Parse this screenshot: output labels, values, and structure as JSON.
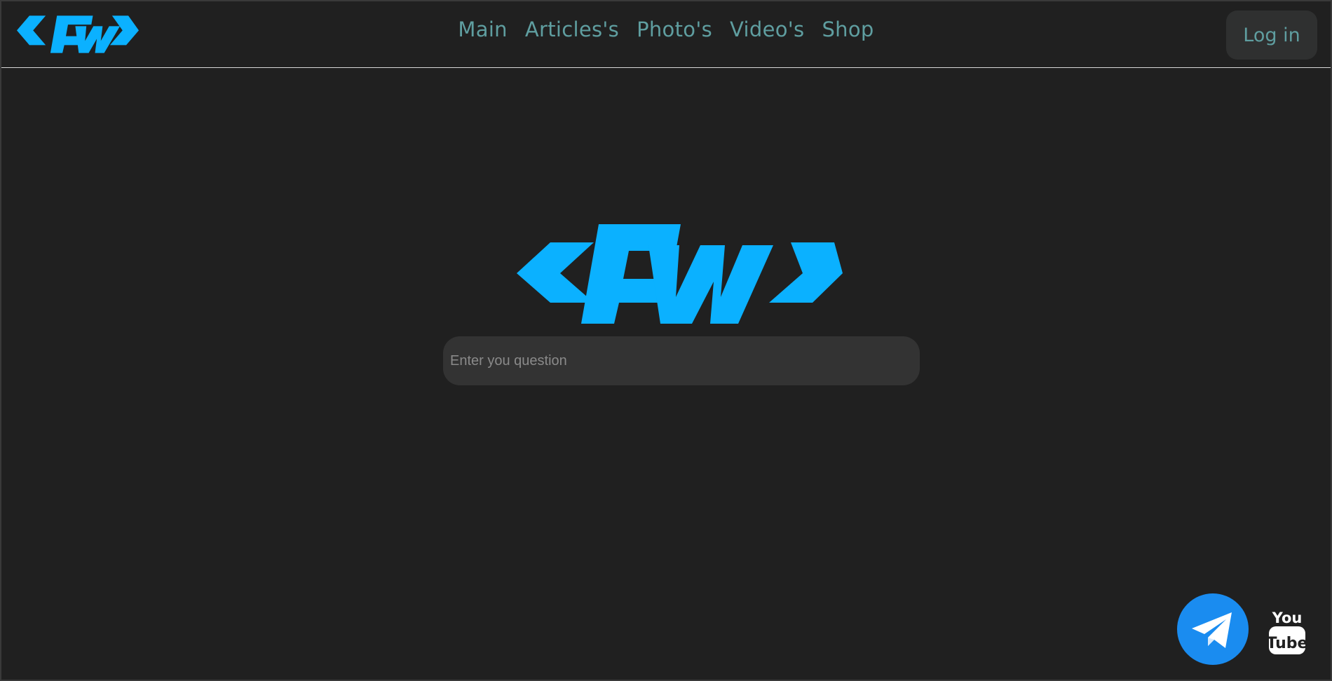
{
  "brand": {
    "logo_text": "<Fw>",
    "color": "#0bb1ff"
  },
  "nav": {
    "items": [
      {
        "label": "Main"
      },
      {
        "label": "Articles's"
      },
      {
        "label": "Photo's"
      },
      {
        "label": "Video's"
      },
      {
        "label": "Shop"
      }
    ],
    "color": "#5f9ea0"
  },
  "header": {
    "login_label": "Log in"
  },
  "search": {
    "placeholder": "Enter you question"
  },
  "social": {
    "telegram_icon": "telegram-icon",
    "telegram_color": "#1a8cf0",
    "youtube_icon": "youtube-icon",
    "youtube_top": "You",
    "youtube_bottom": "Tube"
  },
  "colors": {
    "background": "#202020",
    "input_bg": "#333333",
    "button_bg": "#2f3030"
  }
}
